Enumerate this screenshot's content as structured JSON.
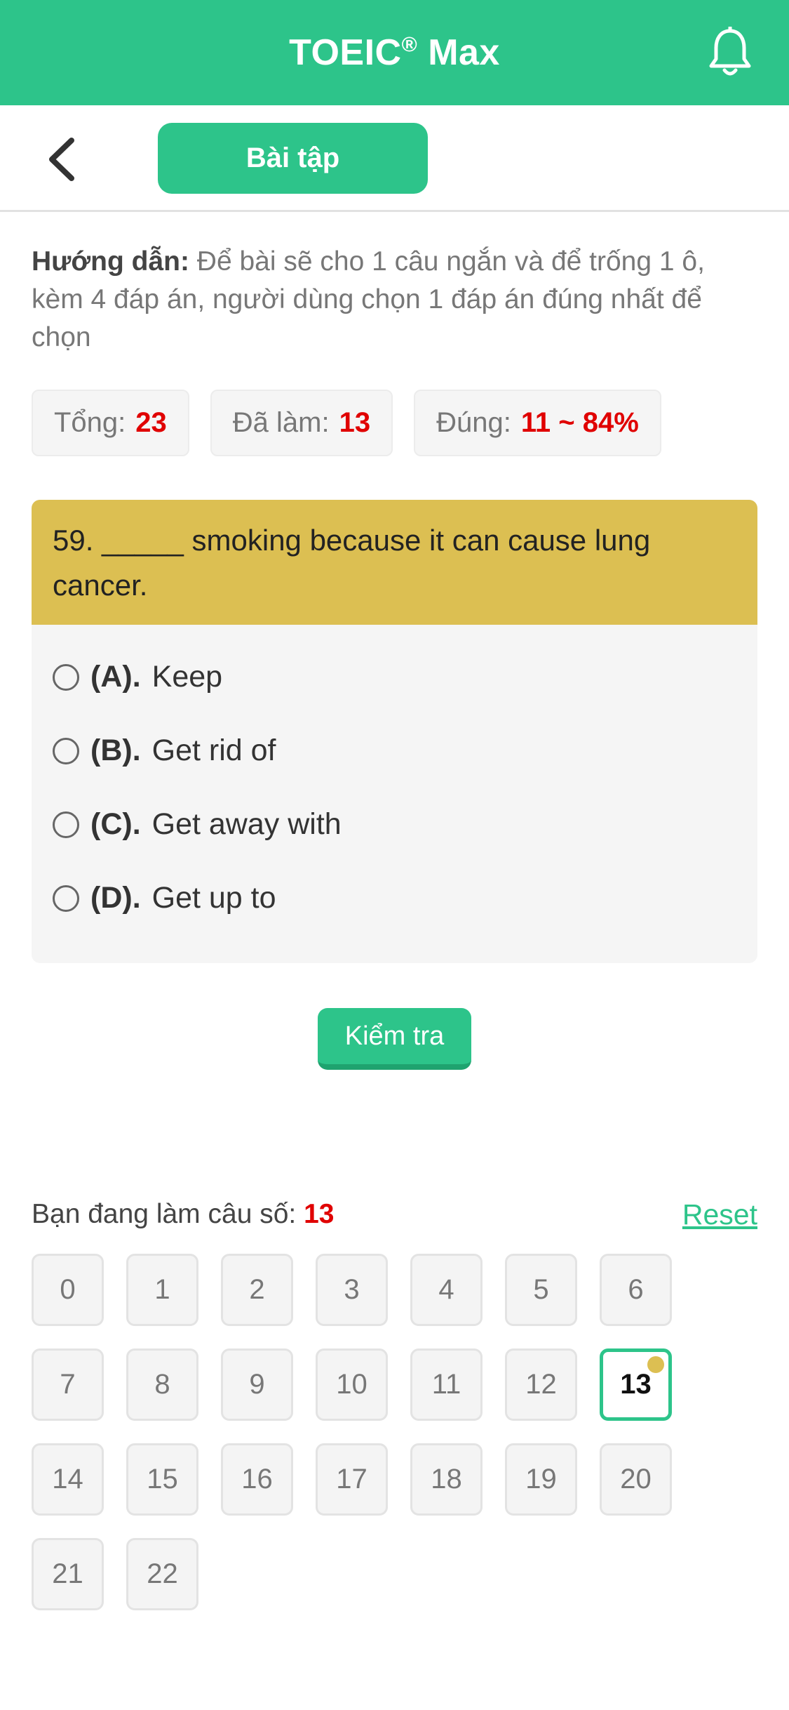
{
  "header": {
    "title_main": "TOEIC",
    "title_reg": "®",
    "title_suffix": "Max",
    "icons": {
      "right": "bell-icon"
    }
  },
  "toolbar": {
    "back_icon": "chevron-left-icon",
    "tab_label": "Bài tập"
  },
  "instructions": {
    "label": "Hướng dẫn:",
    "text": "Để bài sẽ cho 1 câu ngắn và để trống 1 ô, kèm 4 đáp án, người dùng chọn 1 đáp án đúng nhất để chọn"
  },
  "stats": [
    {
      "label": "Tổng:",
      "value": "23"
    },
    {
      "label": "Đã làm:",
      "value": "13"
    },
    {
      "label": "Đúng:",
      "value": "11 ~ 84%"
    }
  ],
  "question": {
    "text": "59. _____ smoking because it can cause lung cancer.",
    "options": [
      {
        "letter": "(A).",
        "text": "Keep"
      },
      {
        "letter": "(B).",
        "text": "Get rid of"
      },
      {
        "letter": "(C).",
        "text": "Get away with"
      },
      {
        "letter": "(D).",
        "text": "Get up to"
      }
    ]
  },
  "check_button": "Kiểm tra",
  "progress": {
    "label": "Bạn đang làm câu số:",
    "current": "13",
    "reset_label": "Reset"
  },
  "question_numbers": [
    "0",
    "1",
    "2",
    "3",
    "4",
    "5",
    "6",
    "7",
    "8",
    "9",
    "10",
    "11",
    "12",
    "13",
    "14",
    "15",
    "16",
    "17",
    "18",
    "19",
    "20",
    "21",
    "22"
  ],
  "active_number": "13",
  "colors": {
    "primary": "#2dc48a",
    "question_bg": "#dcbf52",
    "highlight": "#e00000"
  }
}
